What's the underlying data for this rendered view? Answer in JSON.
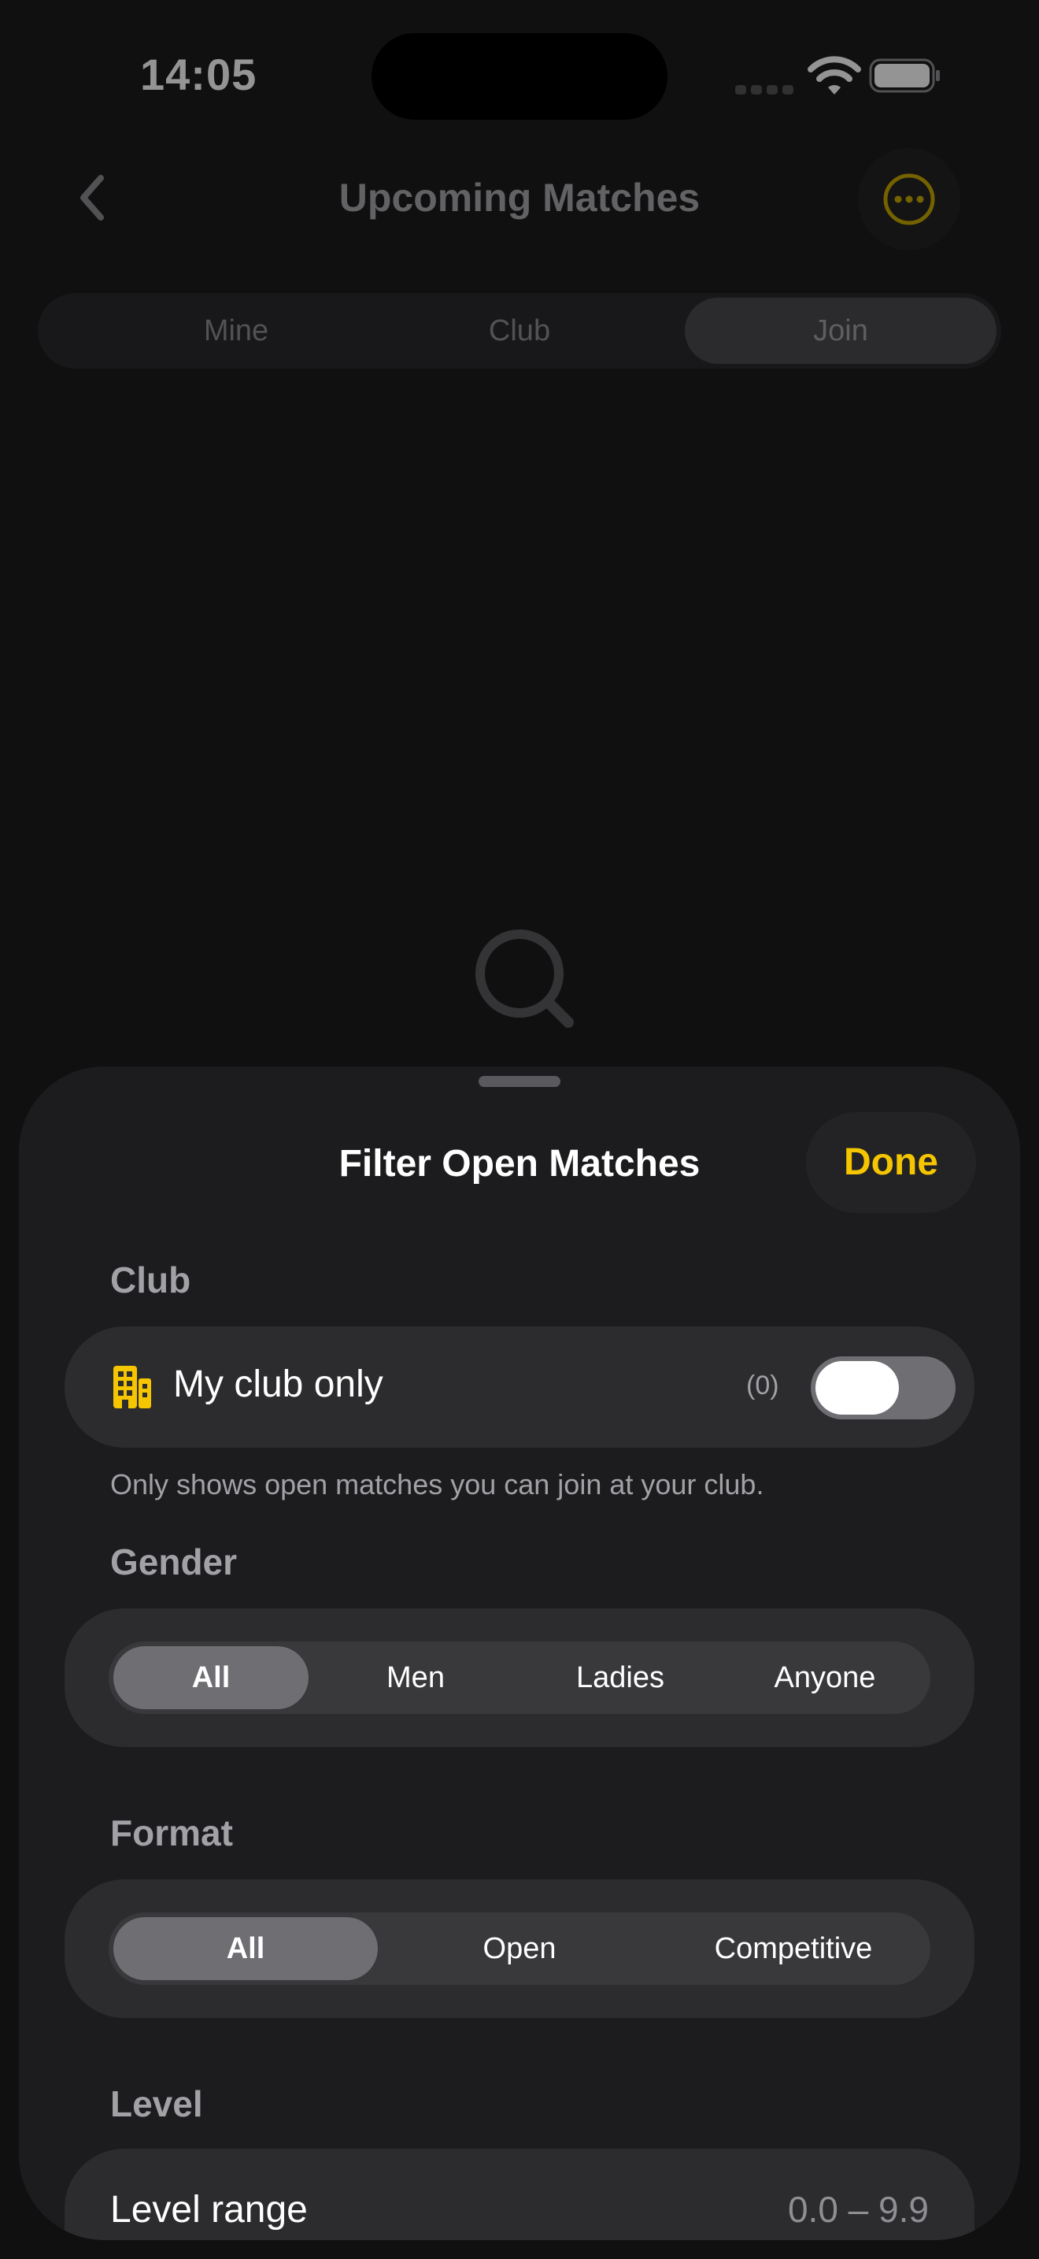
{
  "status_bar": {
    "time": "14:05"
  },
  "nav": {
    "title": "Upcoming Matches",
    "back_icon": "chevron-left-icon",
    "more_icon": "ellipsis-circle-icon"
  },
  "tabs": [
    {
      "label": "Mine",
      "active": false
    },
    {
      "label": "Club",
      "active": false
    },
    {
      "label": "Join",
      "active": true
    }
  ],
  "sheet": {
    "title": "Filter Open Matches",
    "done_label": "Done",
    "club": {
      "section_label": "Club",
      "toggle_label": "My club only",
      "count": "(0)",
      "toggle_on": true,
      "footnote": "Only shows open matches you can join at your club."
    },
    "gender": {
      "section_label": "Gender",
      "options": [
        "All",
        "Men",
        "Ladies",
        "Anyone"
      ],
      "selected": "All"
    },
    "format": {
      "section_label": "Format",
      "options": [
        "All",
        "Open",
        "Competitive"
      ],
      "selected": "All"
    },
    "level": {
      "section_label": "Level",
      "range_label": "Level range",
      "range_value": "0.0 – 9.9"
    }
  },
  "colors": {
    "accent": "#f5c500",
    "sheet_bg": "#1c1c1e",
    "card_bg": "#2c2c2e"
  }
}
